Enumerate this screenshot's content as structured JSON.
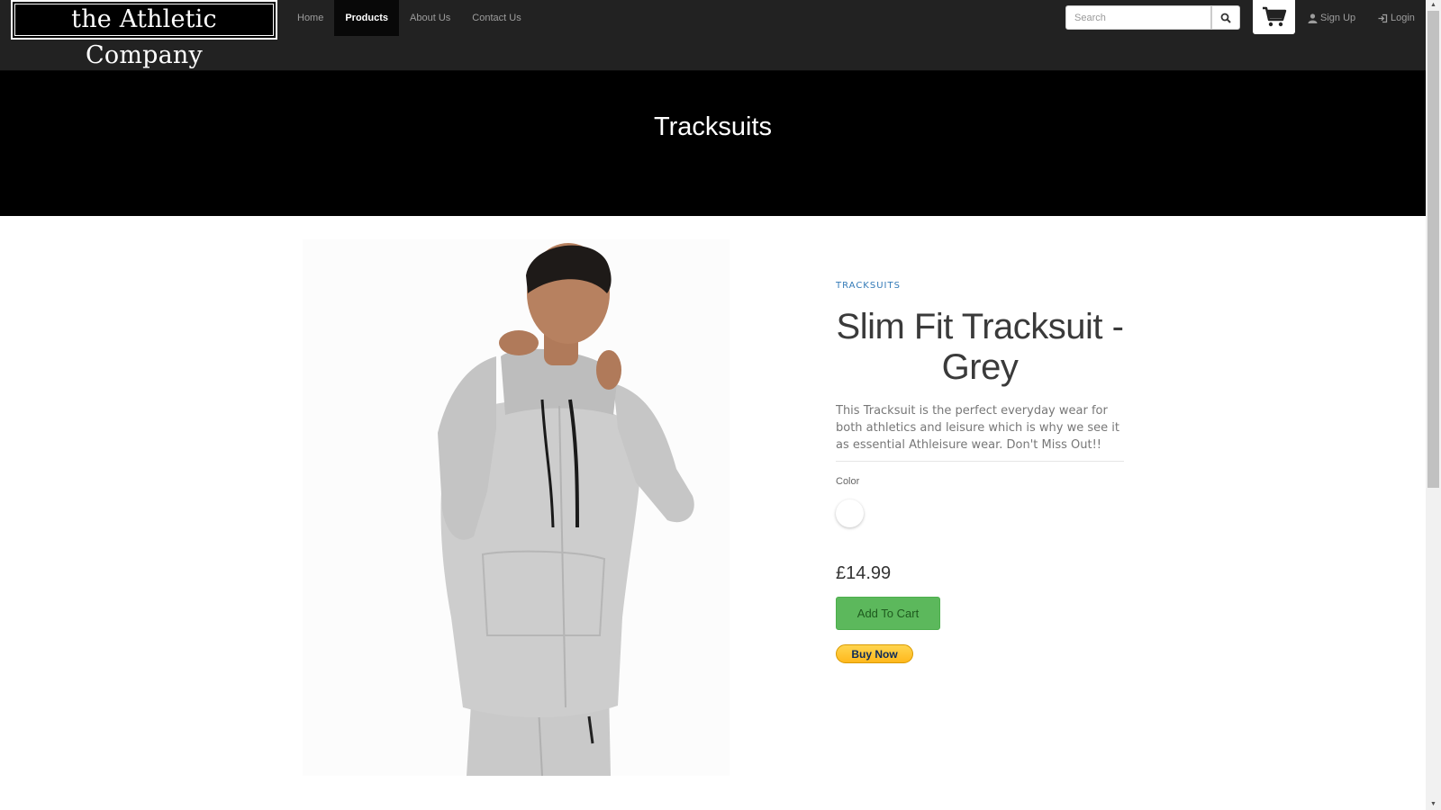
{
  "brand": {
    "name": "the Athletic Company"
  },
  "nav": {
    "links": [
      {
        "label": "Home"
      },
      {
        "label": "Products"
      },
      {
        "label": "About Us"
      },
      {
        "label": "Contact Us"
      }
    ],
    "active_link": "Products",
    "search": {
      "placeholder": "Search",
      "value": ""
    },
    "signup_label": "Sign Up",
    "login_label": "Login"
  },
  "banner": {
    "title": "Tracksuits"
  },
  "product": {
    "category": "TRACKSUITS",
    "name": "Slim Fit Tracksuit - Grey",
    "description": "This Tracksuit is the perfect everyday wear for both athletics and leisure which is why we see it as essential Athleisure wear. Don't Miss Out!!",
    "color_label": "Color",
    "swatch_color": "#ffffff",
    "price": "£14.99",
    "add_to_cart_label": "Add To Cart",
    "buy_now_label": "Buy Now"
  },
  "colors": {
    "navbar": "#222222",
    "banner": "#000000",
    "add_to_cart": "#5cb85c",
    "buy_now": "#ffc439",
    "category_link": "#337ab7",
    "tracksuit_grey": "#c8c8c8"
  }
}
